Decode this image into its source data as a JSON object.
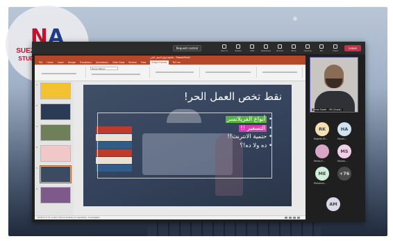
{
  "logo": {
    "mark_n": "N",
    "mark_a": "A",
    "line1": "SUEZ UNIVERSITY",
    "line2": "STUDENT CHAPTER",
    "colors": {
      "red": "#c8102e",
      "blue": "#1f3c88"
    }
  },
  "teams_toolbar": {
    "request_control": "Request control",
    "buttons": [
      {
        "label": "Record",
        "icon": "record-icon"
      },
      {
        "label": "People",
        "icon": "people-icon"
      },
      {
        "label": "Chat",
        "icon": "chat-icon"
      },
      {
        "label": "Reactions",
        "icon": "reactions-icon"
      },
      {
        "label": "Rooms",
        "icon": "rooms-icon"
      },
      {
        "label": "More",
        "icon": "more-icon"
      },
      {
        "label": "Camera",
        "icon": "camera-icon"
      },
      {
        "label": "Mic",
        "icon": "mic-icon"
      },
      {
        "label": "Share",
        "icon": "share-icon"
      }
    ],
    "leave": "Leave"
  },
  "powerpoint": {
    "title": "انواع العمل الحر.pptx - PowerPoint",
    "tabs": [
      "File",
      "Home",
      "Insert",
      "Design",
      "Transitions",
      "Animations",
      "Slide Show",
      "Review",
      "View",
      "Shape Format",
      "Tell me"
    ],
    "active_tab": "Shape Format",
    "font_name": "Hacen Beirut",
    "thumbnails": [
      "1",
      "2",
      "3",
      "4",
      "5",
      "6"
    ],
    "slide": {
      "heading": "نقط تخص العمل الحر!",
      "bullets": [
        "أنواع الفريلانسر",
        "التسعير !!",
        "حتمية الانترنت!!",
        "ده ولا ده!؟"
      ]
    },
    "status_left": "Slide 6 of 11    Arabic (Saudi Arabia)    Accessibility: Investigate",
    "colors": {
      "accent": "#b7472a",
      "highlight_green": "#57b33f",
      "highlight_pink": "#d13fb0"
    }
  },
  "caption": "Omar Elsaid - OM (Guest)",
  "participants": {
    "video_name": "Omar Elsaid - OM (Guest)",
    "avatars": [
      {
        "initials": "RK",
        "label": "Raghda Kh...",
        "color": "#f5e0b5"
      },
      {
        "initials": "HA",
        "label": "Hanan...",
        "color": "#cfe3f0"
      },
      {
        "initials": "",
        "label": "Fatma E...",
        "color": "#d9a7c6"
      },
      {
        "initials": "MS",
        "label": "Marwa...",
        "color": "#f0d0e8"
      },
      {
        "initials": "ME",
        "label": "Mohamm...",
        "color": "#cfeeda"
      },
      {
        "initials": "+76",
        "label": "",
        "color": "#4a4a4a"
      },
      {
        "initials": "AM",
        "label": "",
        "color": "#d8d8e8"
      }
    ]
  }
}
